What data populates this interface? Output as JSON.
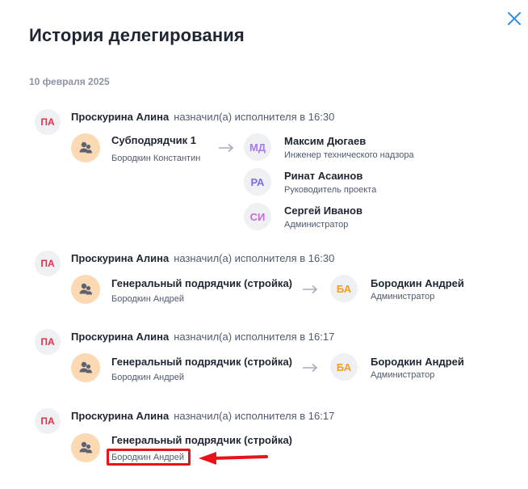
{
  "dialog": {
    "title": "История делегирования",
    "date": "10 февраля 2025"
  },
  "colors": {
    "accent": "#2f8de4",
    "author_initials": "#e0314b",
    "user_md": "#a47de6",
    "user_ra": "#7b6fe8",
    "user_si": "#c86bd9",
    "user_ba": "#f39c1f",
    "group_avatar_bg": "#fbd9b3",
    "highlight": "#e8121a"
  },
  "icons": {
    "close": "close-icon",
    "group": "people-icon",
    "arrow": "arrow-right-icon"
  },
  "entries": [
    {
      "author_initials": "ПА",
      "author_name": "Проскурина Алина",
      "action": "назначил(а) исполнителя в 16:30",
      "group_name": "Субподрядчик 1",
      "group_person": "Бородкин Константин",
      "users": [
        {
          "initials": "МД",
          "name": "Максим Дюгаев",
          "role": "Инженер технического надзора"
        },
        {
          "initials": "РА",
          "name": "Ринат Асаинов",
          "role": "Руководитель проекта"
        },
        {
          "initials": "СИ",
          "name": "Сергей Иванов",
          "role": "Администратор"
        }
      ]
    },
    {
      "author_initials": "ПА",
      "author_name": "Проскурина Алина",
      "action": "назначил(а) исполнителя в 16:30",
      "group_name": "Генеральный подрядчик (стройка)",
      "group_person": "Бородкин Андрей",
      "users": [
        {
          "initials": "БА",
          "name": "Бородкин Андрей",
          "role": "Администратор"
        }
      ]
    },
    {
      "author_initials": "ПА",
      "author_name": "Проскурина Алина",
      "action": "назначил(а) исполнителя в 16:17",
      "group_name": "Генеральный подрядчик (стройка)",
      "group_person": "Бородкин Андрей",
      "users": [
        {
          "initials": "БА",
          "name": "Бородкин Андрей",
          "role": "Администратор"
        }
      ]
    },
    {
      "author_initials": "ПА",
      "author_name": "Проскурина Алина",
      "action": "назначил(а) исполнителя в 16:17",
      "group_name": "Генеральный подрядчик (стройка)",
      "group_person": "Бородкин Андрей",
      "users": []
    }
  ]
}
